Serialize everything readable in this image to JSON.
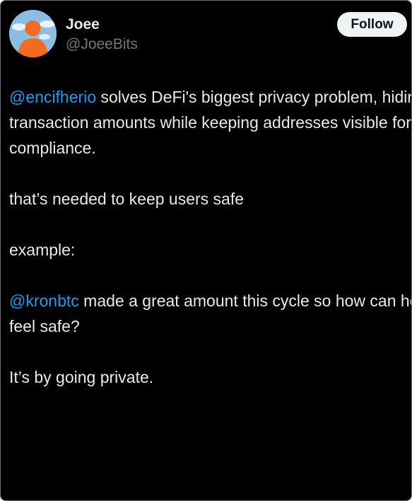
{
  "author": {
    "display_name": "Joee",
    "handle": "@JoeeBits",
    "avatar_icon": "orange-person-avatar-icon"
  },
  "follow_button": {
    "label": "Follow"
  },
  "tweet": {
    "p1": {
      "mention": "@encifherio",
      "text": " solves DeFi's biggest privacy problem, hiding transaction amounts while keeping addresses visible for compliance."
    },
    "p2": {
      "text": "that’s needed to keep users safe"
    },
    "p3": {
      "text": "example:"
    },
    "p4": {
      "mention": "@kronbtc",
      "text": " made a great amount this cycle so how can he feel safe?"
    },
    "p5": {
      "text": "It’s by going private."
    }
  },
  "colors": {
    "background": "#000000",
    "text": "#e7e9ea",
    "secondary_text": "#71767b",
    "mention": "#1d9bf0",
    "follow_bg": "#eff3f4",
    "avatar_orange": "#f26b21"
  }
}
